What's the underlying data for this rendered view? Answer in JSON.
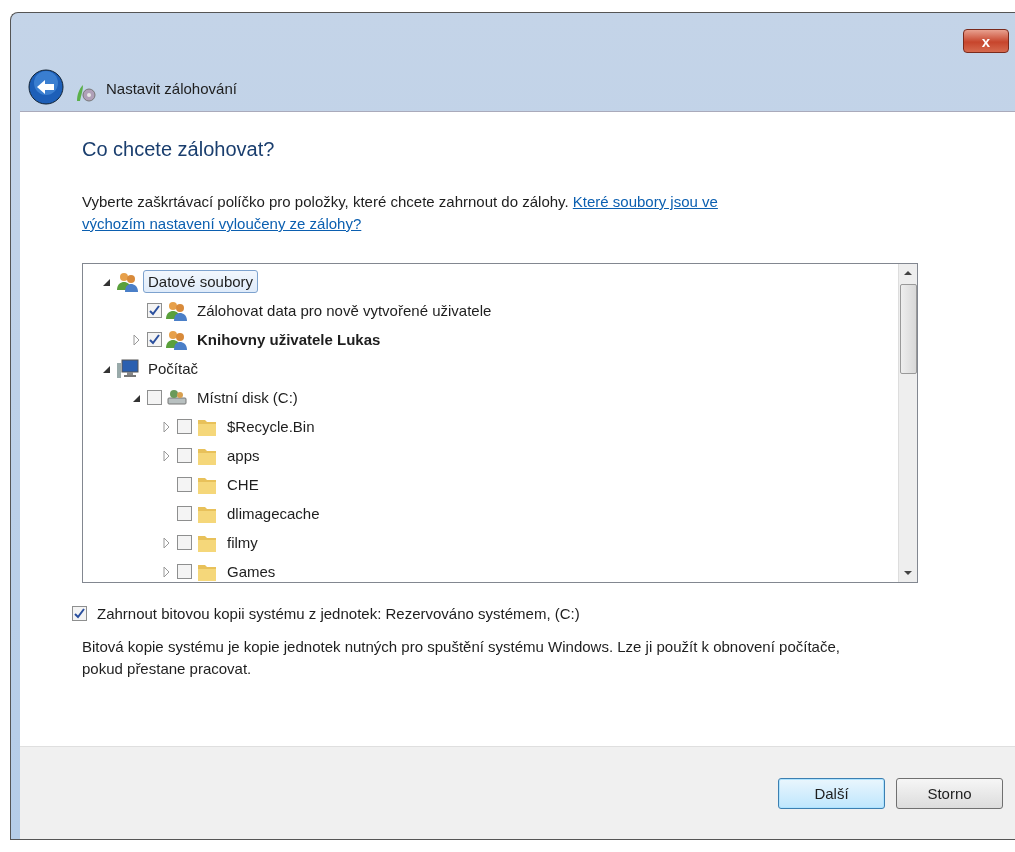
{
  "window": {
    "title": "Nastavit zálohování",
    "close_label": "x"
  },
  "heading": "Co chcete zálohovat?",
  "intro": {
    "text": "Vyberte zaškrtávací políčko pro položky, které chcete zahrnout do zálohy.",
    "link_lines": [
      "Které soubory jsou ve",
      "výchozím nastavení vyloučeny ze zálohy?"
    ]
  },
  "tree": [
    {
      "label": "Datové soubory",
      "kind": "users",
      "selected": true,
      "bold": false,
      "expanded": true,
      "children": [
        {
          "label": "Zálohovat data pro nově vytvořené uživatele",
          "kind": "users",
          "selected": false,
          "bold": false,
          "checked": true
        },
        {
          "label": "Knihovny uživatele Lukas",
          "kind": "users",
          "selected": false,
          "bold": true,
          "checked": true,
          "expanded": false
        }
      ]
    },
    {
      "label": "Počítač",
      "kind": "computer",
      "selected": false,
      "bold": false,
      "expanded": true,
      "children": [
        {
          "label": "Místní disk (C:)",
          "kind": "disk",
          "selected": false,
          "bold": false,
          "checked": false,
          "expanded": true,
          "children": [
            {
              "label": "$Recycle.Bin",
              "kind": "folder",
              "selected": false,
              "bold": false,
              "checked": false,
              "expanded": false
            },
            {
              "label": "apps",
              "kind": "folder",
              "selected": false,
              "bold": false,
              "checked": false,
              "expanded": false
            },
            {
              "label": "CHE",
              "kind": "folder",
              "selected": false,
              "bold": false,
              "checked": false
            },
            {
              "label": "dlimagecache",
              "kind": "folder",
              "selected": false,
              "bold": false,
              "checked": false
            },
            {
              "label": "filmy",
              "kind": "folder",
              "selected": false,
              "bold": false,
              "checked": false,
              "expanded": false
            },
            {
              "label": "Games",
              "kind": "folder",
              "selected": false,
              "bold": false,
              "checked": false,
              "expanded": false
            }
          ]
        }
      ]
    }
  ],
  "system_image": {
    "label": "Zahrnout bitovou kopii systému z jednotek: Rezervováno systémem, (C:)",
    "checked": true
  },
  "system_image_note": "Bitová kopie systému je kopie jednotek nutných pro spuštění systému Windows. Lze ji použít k obnovení počítače, pokud přestane pracovat.",
  "buttons": [
    {
      "label": "Další",
      "default": true
    },
    {
      "label": "Storno",
      "default": false
    }
  ]
}
